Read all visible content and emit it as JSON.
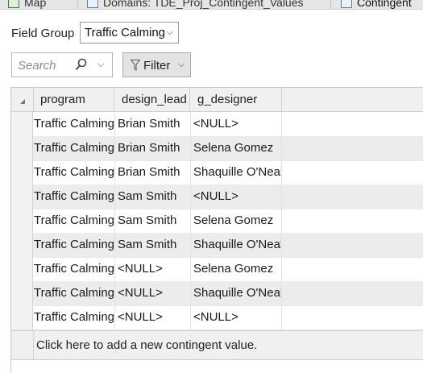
{
  "tabs": [
    {
      "label": "Map",
      "icon": "map-icon"
    },
    {
      "label": "Domains: TDE_Proj_Contingent_Values",
      "icon": "table-icon"
    },
    {
      "label": "Contingent",
      "icon": "table-icon"
    }
  ],
  "field_group": {
    "label": "Field Group",
    "selected": "Traffic Calming"
  },
  "search": {
    "placeholder": "Search"
  },
  "filter": {
    "label": "Filter"
  },
  "grid": {
    "columns": [
      "program",
      "design_lead",
      "g_designer"
    ],
    "rows": [
      [
        "Traffic Calming",
        "Brian Smith",
        "<NULL>"
      ],
      [
        "Traffic Calming",
        "Brian Smith",
        "Selena Gomez"
      ],
      [
        "Traffic Calming",
        "Brian Smith",
        "Shaquille O'Neal"
      ],
      [
        "Traffic Calming",
        "Sam Smith",
        "<NULL>"
      ],
      [
        "Traffic Calming",
        "Sam Smith",
        "Selena Gomez"
      ],
      [
        "Traffic Calming",
        "Sam Smith",
        "Shaquille O'Neal"
      ],
      [
        "Traffic Calming",
        "<NULL>",
        "Selena Gomez"
      ],
      [
        "Traffic Calming",
        "<NULL>",
        "Shaquille O'Neal"
      ],
      [
        "Traffic Calming",
        "<NULL>",
        "<NULL>"
      ]
    ],
    "add_row_text": "Click here to add a new contingent value."
  }
}
